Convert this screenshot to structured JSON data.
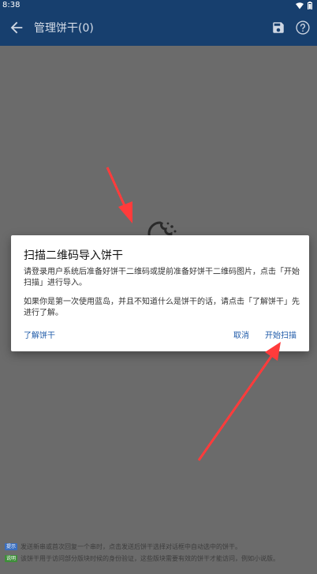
{
  "status_bar": {
    "time": "8:38"
  },
  "app_bar": {
    "title": "管理饼干(0)"
  },
  "dialog": {
    "title": "扫描二维码导入饼干",
    "body_1": "请登录用户系统后准备好饼干二维码或提前准备好饼干二维码图片，点击「开始扫描」进行导入。",
    "body_2": "如果你是第一次使用蓝岛，并且不知道什么是饼干的话，请点击「了解饼干」先进行了解。",
    "learn_label": "了解饼干",
    "cancel_label": "取消",
    "scan_label": "开始扫描"
  },
  "footer": {
    "tag_1": "提示",
    "line_1": "发送新串或首次回复一个串时，点击发送后饼干选择对话框中自动选中的饼干。",
    "tag_2": "说明",
    "line_2": "该饼干用于访问部分版块时候的身份验证，这些版块需要有效的饼干才能访问，例如小说版。"
  },
  "colors": {
    "app_bar": "#173f6e",
    "accent": "#1e5aa8",
    "overlay": "#6b6b6b",
    "arrow": "#ff3b3b"
  },
  "icons": [
    "wifi-icon",
    "battery-icon",
    "back-arrow-icon",
    "save-icon",
    "help-icon",
    "cookie-icon"
  ]
}
